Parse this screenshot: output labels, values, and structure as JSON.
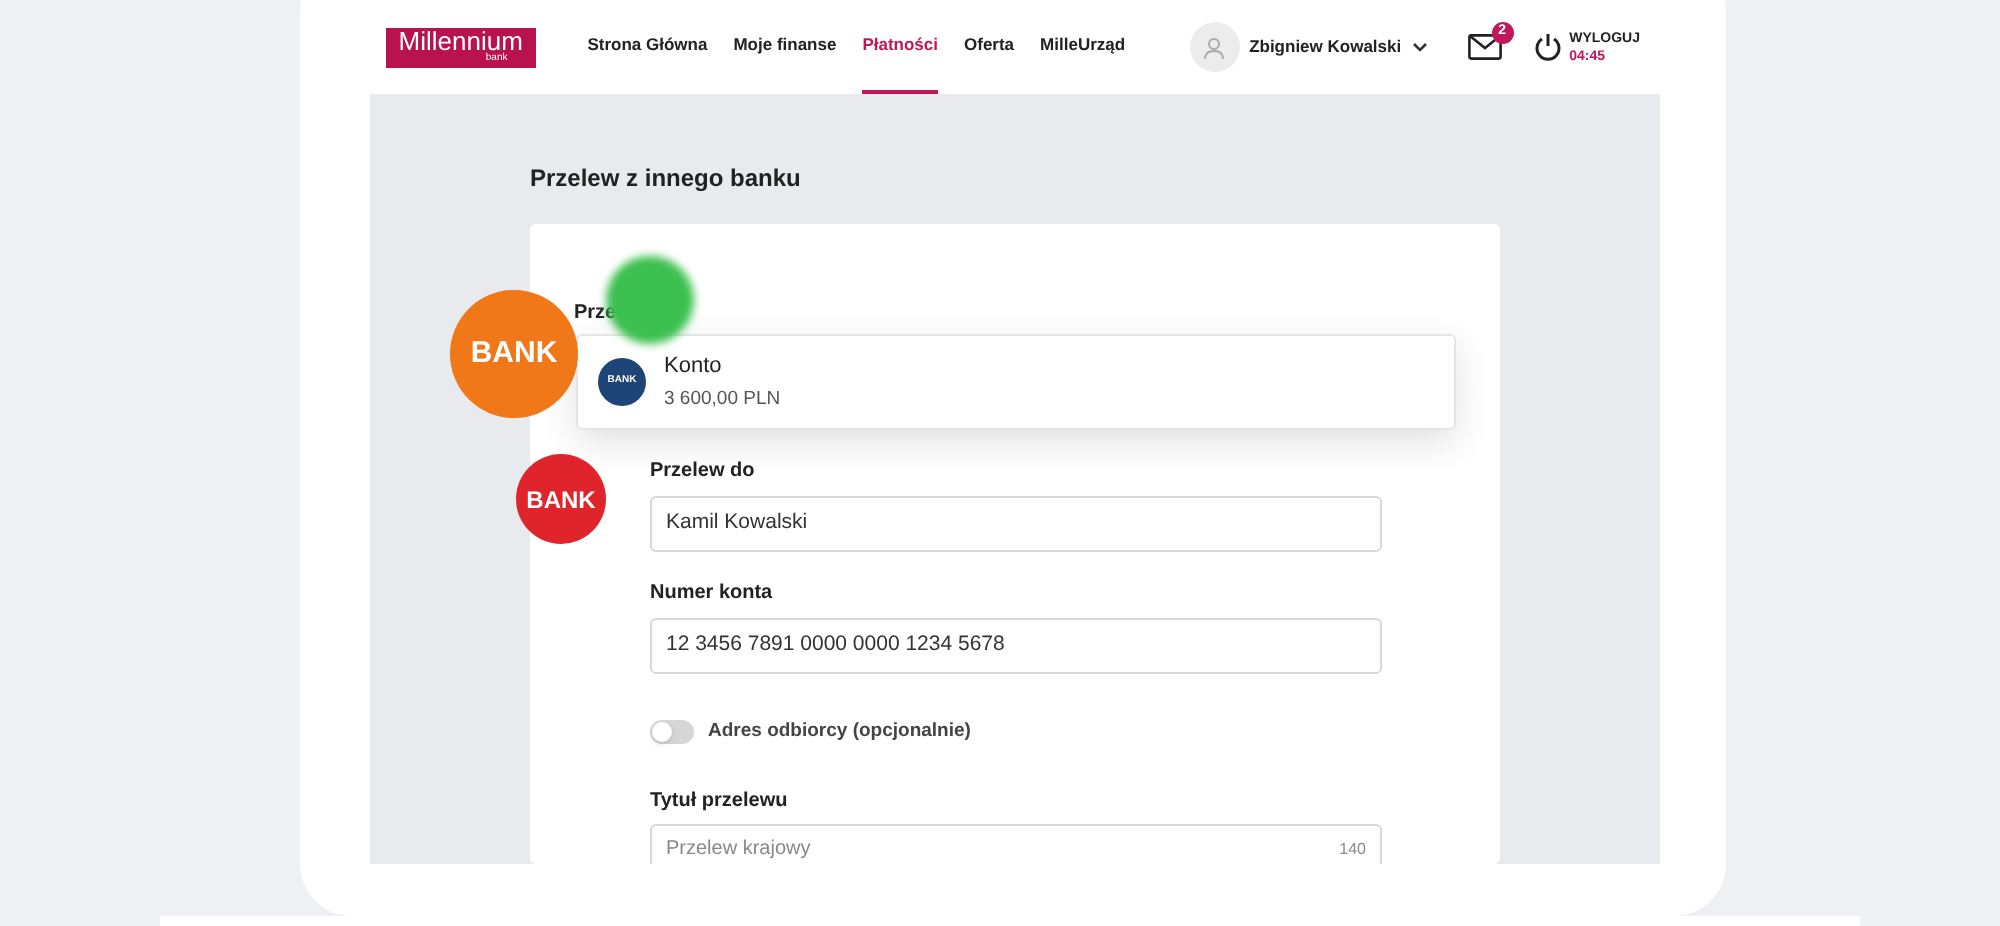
{
  "header": {
    "logo": {
      "name": "Millennium",
      "sub": "bank"
    },
    "nav": [
      {
        "label": "Strona Główna",
        "selected": false
      },
      {
        "label": "Moje finanse",
        "selected": false
      },
      {
        "label": "Płatności",
        "selected": true
      },
      {
        "label": "Oferta",
        "selected": false
      },
      {
        "label": "MilleUrząd",
        "selected": false
      }
    ],
    "user": {
      "name": "Zbigniew Kowalski"
    },
    "messages": {
      "badge": "2"
    },
    "logout": {
      "label": "WYLOGUJ",
      "timer": "04:45"
    }
  },
  "page": {
    "title": "Przelew z innego banku"
  },
  "form": {
    "from_label": "Prze",
    "account": {
      "logo": "BANK",
      "name": "Konto",
      "balance": "3 600,00 PLN"
    },
    "fields": [
      {
        "label": "Przelew do",
        "value": "Kamil Kowalski"
      },
      {
        "label": "Numer konta",
        "value": "12 3456 7891 0000 0000 1234 5678"
      }
    ],
    "toggle": {
      "label": "Adres odbiorcy (opcjonalnie)",
      "on": false
    },
    "title_field": {
      "label": "Tytuł przelewu",
      "placeholder": "Przelew krajowy",
      "counter": "140"
    }
  },
  "bubbles": [
    {
      "label": "BANK",
      "color": "#f07818",
      "blurred": false
    },
    {
      "color": "#3cc050",
      "blurred": true
    },
    {
      "label": "BANK",
      "color": "#e0242c",
      "blurred": false
    }
  ]
}
